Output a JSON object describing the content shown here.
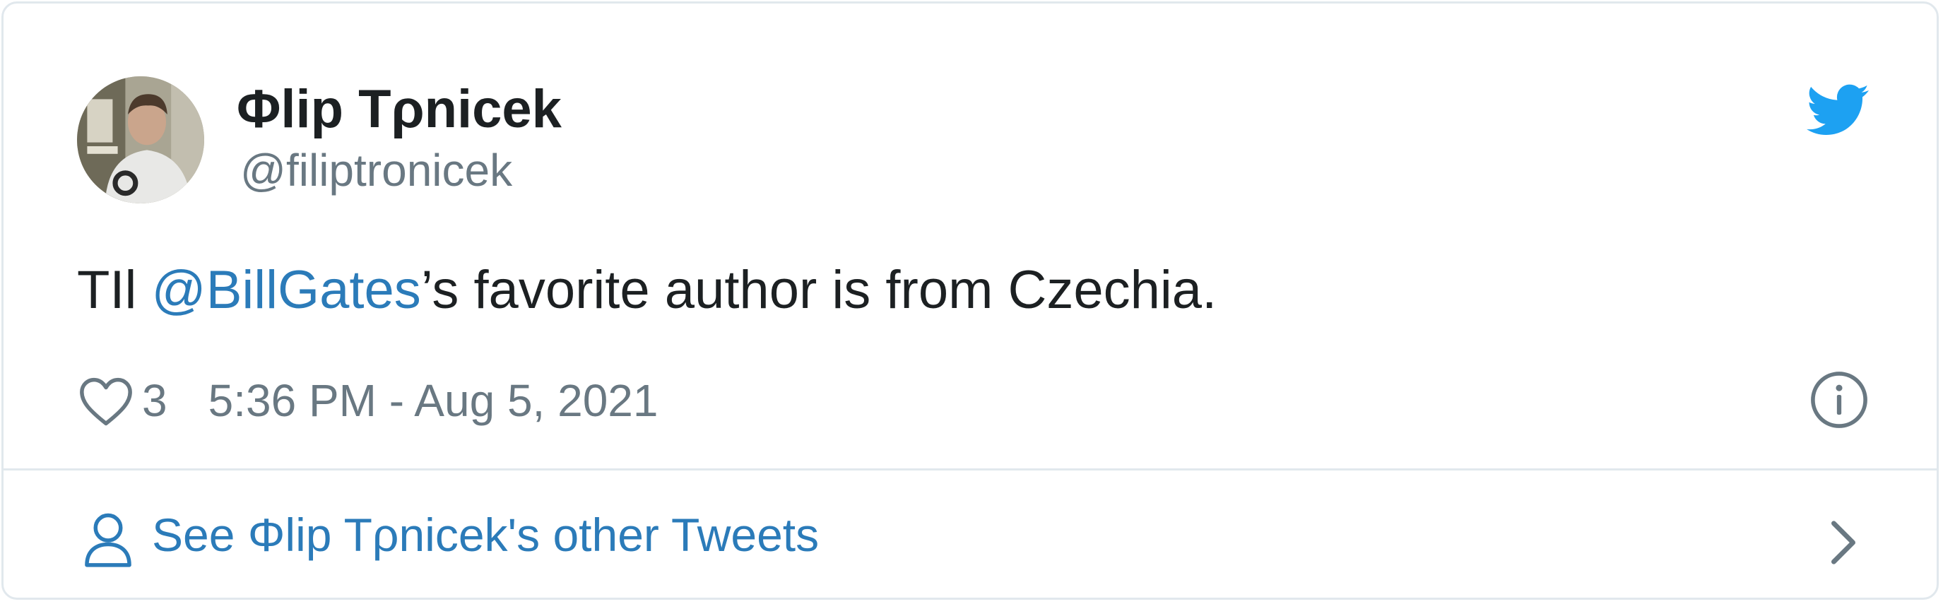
{
  "user": {
    "display_name": "Φlip Tρnicek",
    "handle": "@filiptronicek"
  },
  "tweet": {
    "text_before": "TIl ",
    "mention": "@BillGates",
    "text_after": "’s favorite author is from Czechia."
  },
  "meta": {
    "like_count": "3",
    "timestamp": "5:36 PM - Aug 5, 2021"
  },
  "footer": {
    "link_label": "See Φlip Tρnicek's other Tweets"
  },
  "icons": {
    "brand": "twitter-bird-icon",
    "like": "heart-icon",
    "info": "info-icon",
    "profile": "person-icon",
    "more": "chevron-right-icon"
  },
  "colors": {
    "twitter_blue": "#1da1f2",
    "link_blue": "#2b7bb9",
    "text_primary": "#1c2022",
    "text_secondary": "#697882",
    "border": "#e1e8ed"
  }
}
